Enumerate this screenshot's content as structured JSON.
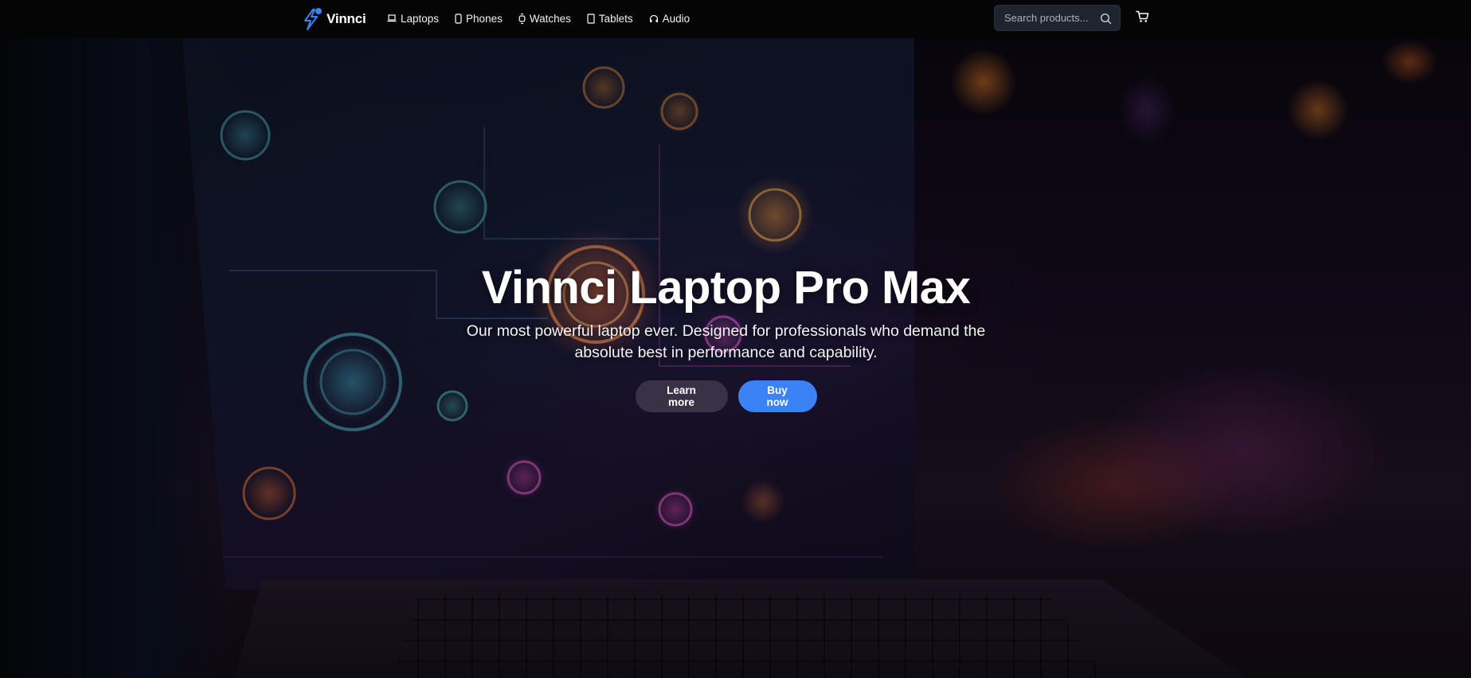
{
  "brand": {
    "name": "Vinnci",
    "accent": "#3b82f6"
  },
  "nav": {
    "items": [
      {
        "label": "Laptops",
        "icon": "laptop-icon"
      },
      {
        "label": "Phones",
        "icon": "phone-icon"
      },
      {
        "label": "Watches",
        "icon": "watch-icon"
      },
      {
        "label": "Tablets",
        "icon": "tablet-icon"
      },
      {
        "label": "Audio",
        "icon": "headphones-icon"
      }
    ]
  },
  "search": {
    "placeholder": "Search products..."
  },
  "cart": {
    "icon": "cart-icon"
  },
  "hero": {
    "title": "Vinnci Laptop Pro Max",
    "subtitle": "Our most powerful laptop ever. Designed for professionals who demand the absolute best in performance and capability.",
    "secondary_button": "Learn more",
    "primary_button": "Buy now"
  }
}
